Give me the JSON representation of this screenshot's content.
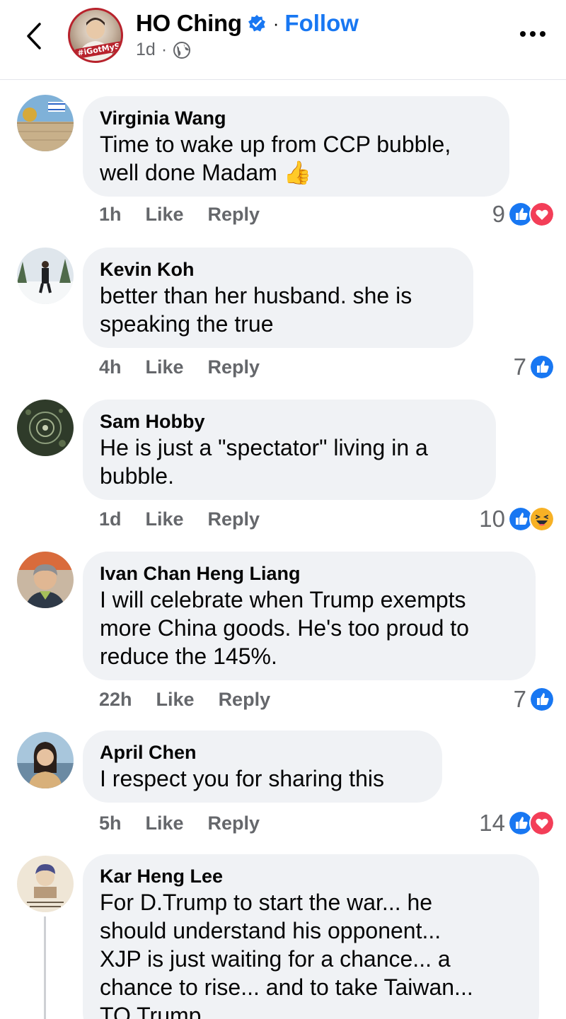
{
  "header": {
    "page_name": "HO Ching",
    "dot": "·",
    "follow_label": "Follow",
    "time": "1d",
    "meta_dot": "·",
    "avatar_badge": "#iGotMyShot",
    "icons": {
      "back": "chevron-left-icon",
      "verified": "verified-badge-icon",
      "audience": "globe-icon",
      "more": "more-dots-icon"
    }
  },
  "colors": {
    "accent": "#1877f2",
    "like": "#1877f2",
    "love": "#f33e58",
    "haha": "#f7b125",
    "bubble": "#f0f2f5",
    "meta_text": "#65676b"
  },
  "comments": [
    {
      "author": "Virginia Wang",
      "lines": [
        "Time to wake up from CCP bubble,",
        "well done Madam 👍"
      ],
      "time": "1h",
      "like": "Like",
      "reply": "Reply",
      "reaction_count": "9",
      "reactions": [
        "like",
        "love"
      ]
    },
    {
      "author": "Kevin Koh",
      "lines": [
        "better than her husband. she is",
        "speaking the true"
      ],
      "time": "4h",
      "like": "Like",
      "reply": "Reply",
      "reaction_count": "7",
      "reactions": [
        "like"
      ]
    },
    {
      "author": "Sam Hobby",
      "lines": [
        "He is just a \"spectator\" living in a",
        "bubble."
      ],
      "time": "1d",
      "like": "Like",
      "reply": "Reply",
      "reaction_count": "10",
      "reactions": [
        "like",
        "haha"
      ]
    },
    {
      "author": "Ivan Chan Heng Liang",
      "lines": [
        "I will celebrate when Trump exempts",
        "more China goods. He's too proud to",
        "reduce the 145%."
      ],
      "time": "22h",
      "like": "Like",
      "reply": "Reply",
      "reaction_count": "7",
      "reactions": [
        "like"
      ]
    },
    {
      "author": "April Chen",
      "lines": [
        "I respect you for sharing this"
      ],
      "time": "5h",
      "like": "Like",
      "reply": "Reply",
      "reaction_count": "14",
      "reactions": [
        "like",
        "love"
      ]
    },
    {
      "author": "Kar Heng Lee",
      "lines": [
        "For D.Trump to start the war... he",
        "should understand his opponent...",
        "XJP is just waiting for a chance... a",
        "chance to rise... and to take Taiwan...",
        "TO Trump"
      ]
    }
  ]
}
